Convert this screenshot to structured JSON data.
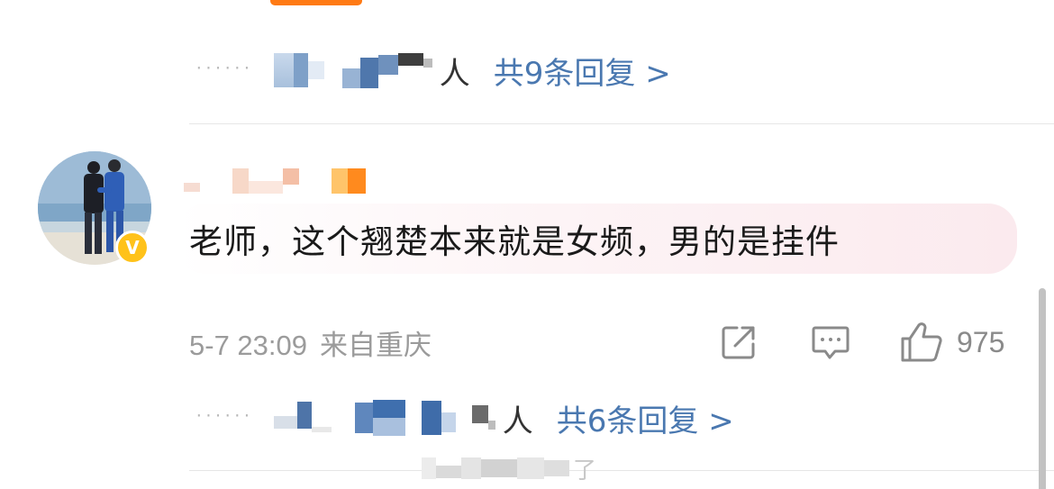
{
  "top_accent": {
    "color": "#ff7a14"
  },
  "reply_preview_1": {
    "dots": "······",
    "suffix": "人",
    "count_text": "共9条回复 >"
  },
  "comment": {
    "verified_badge": "V",
    "text": "老师，这个翘楚本来就是女频，男的是挂件",
    "timestamp": "5-7 23:09",
    "location": "来自重庆",
    "like_count": "975"
  },
  "reply_preview_2": {
    "dots": "······",
    "suffix": "人",
    "count_text": "共6条回复 >"
  },
  "bottom_toast": {
    "tail": "了"
  },
  "icons": {
    "share": "share-icon",
    "comment": "comment-icon",
    "like": "thumbs-up-icon",
    "verified": "verified-badge-icon"
  },
  "colors": {
    "link": "#4a78b0",
    "verified": "#ffc21a",
    "meta": "#9b9b9b"
  }
}
